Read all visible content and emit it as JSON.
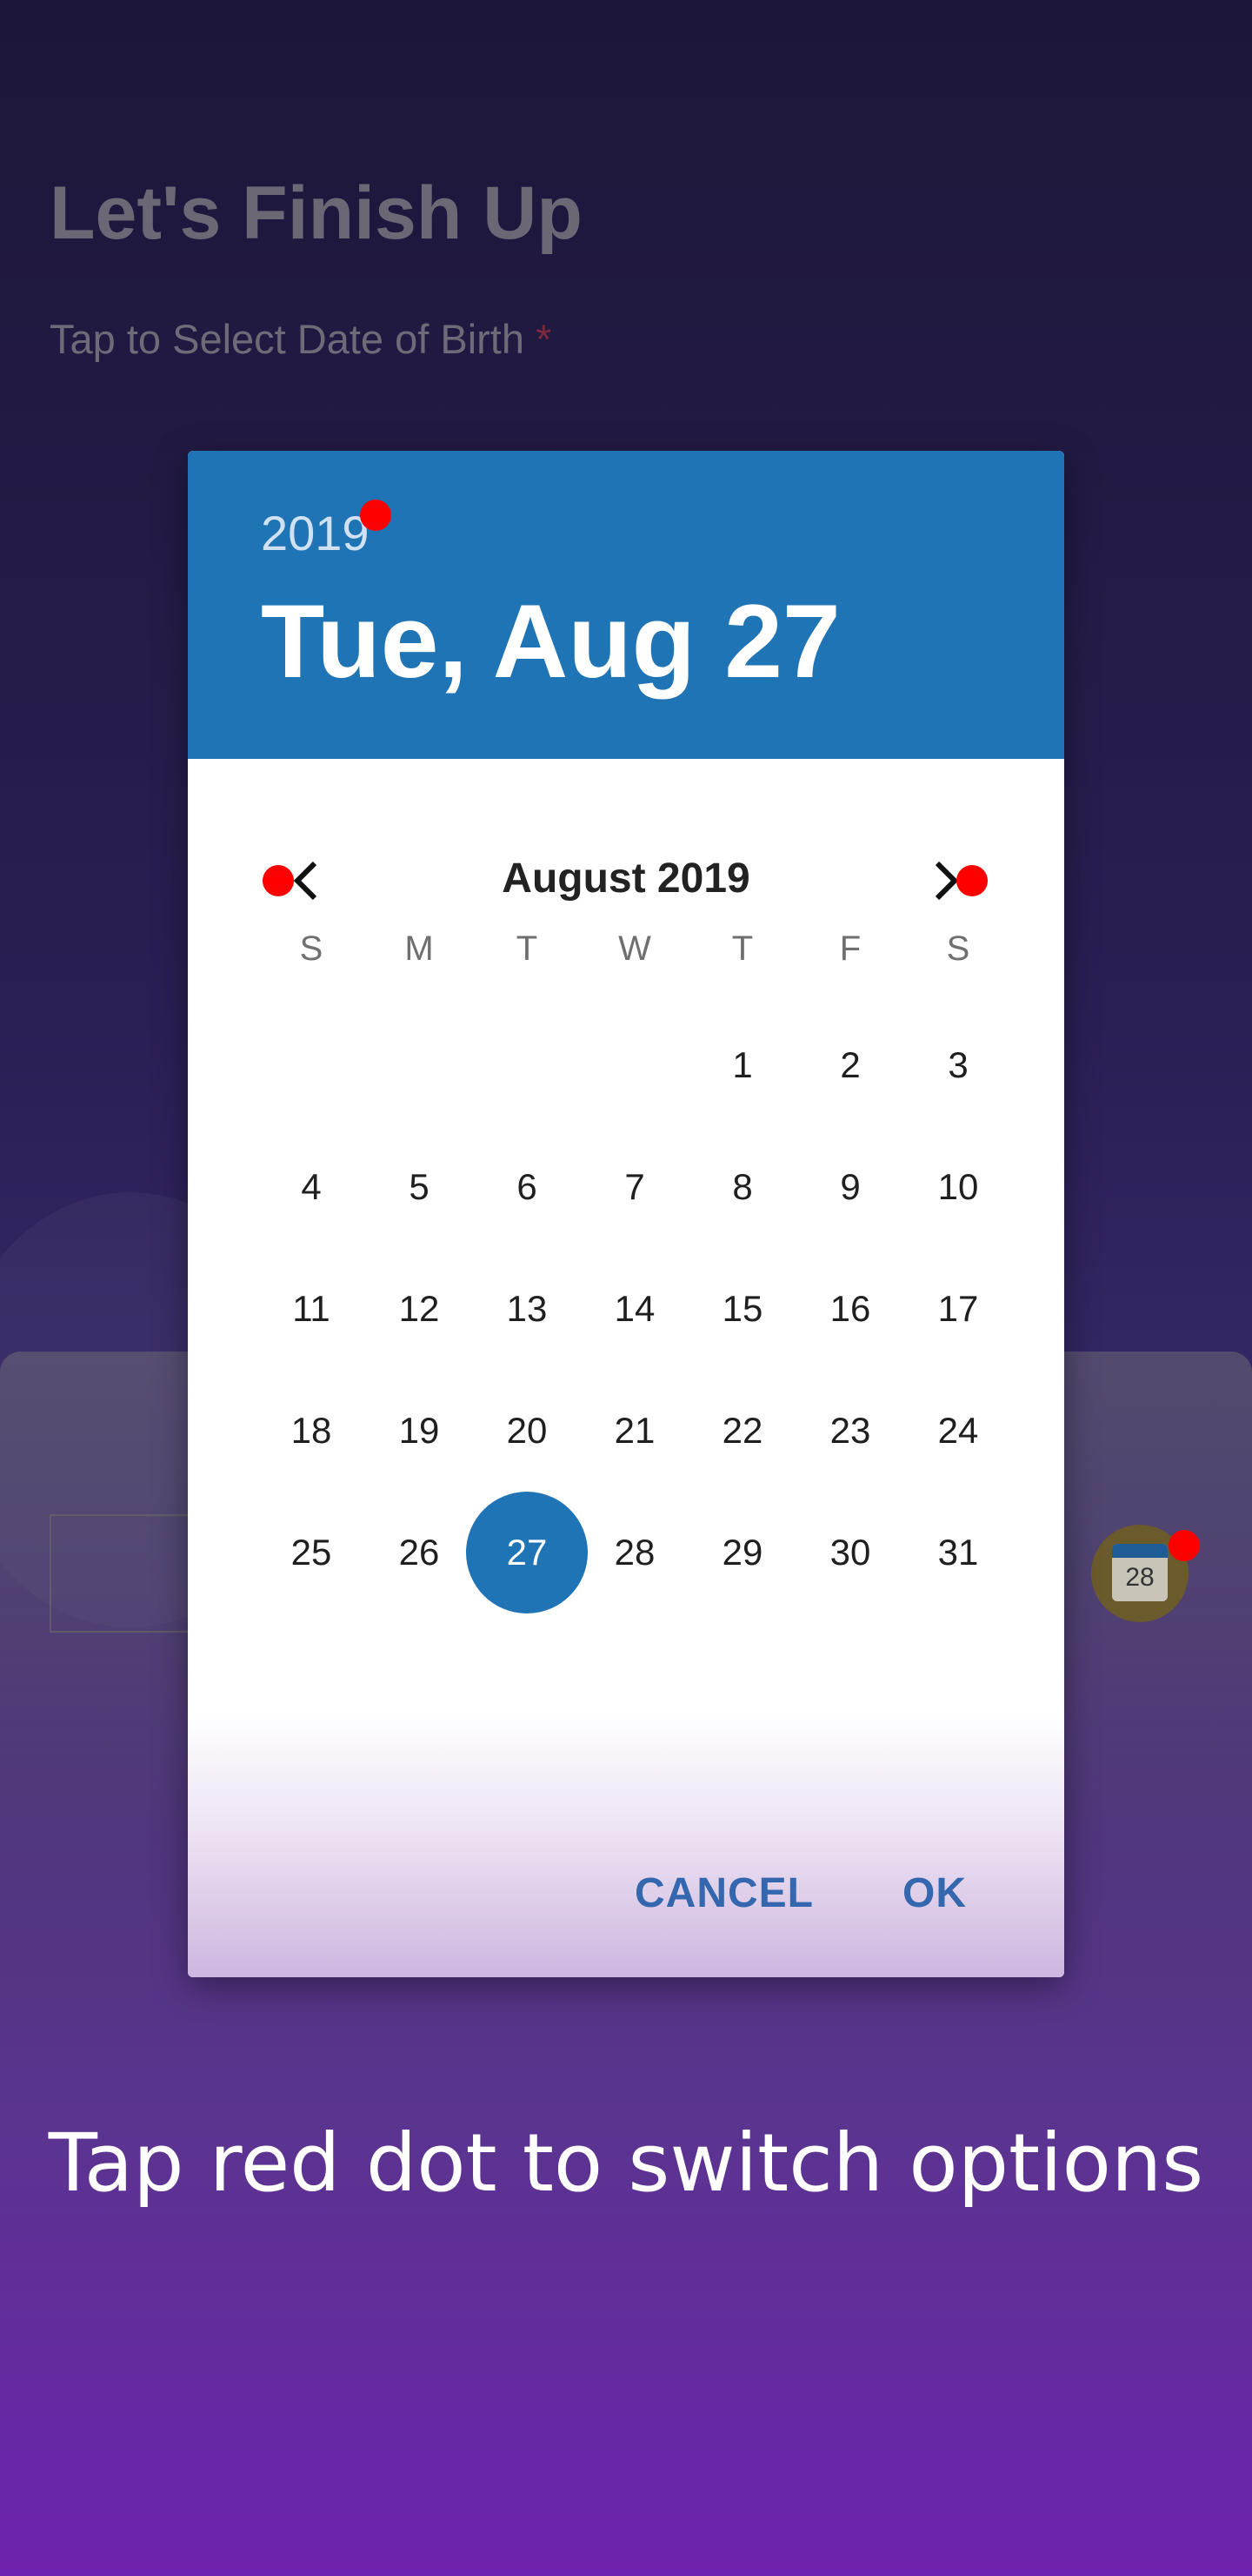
{
  "background": {
    "title": "Let's Finish Up",
    "subtitle": "Tap to Select Date of Birth",
    "required_mark": "*",
    "calendar_icon_day": "28"
  },
  "dialog": {
    "header_year": "2019",
    "header_date": "Tue, Aug 27",
    "month_label": "August 2019",
    "weekdays": [
      "S",
      "M",
      "T",
      "W",
      "T",
      "F",
      "S"
    ],
    "first_weekday_index": 4,
    "days_in_month": 31,
    "selected_day": 27,
    "cancel_label": "CANCEL",
    "ok_label": "OK"
  },
  "caption": "Tap red dot to switch options",
  "colors": {
    "accent": "#1f74b6",
    "button_text": "#3467ad",
    "red_dot": "#ff0000"
  }
}
